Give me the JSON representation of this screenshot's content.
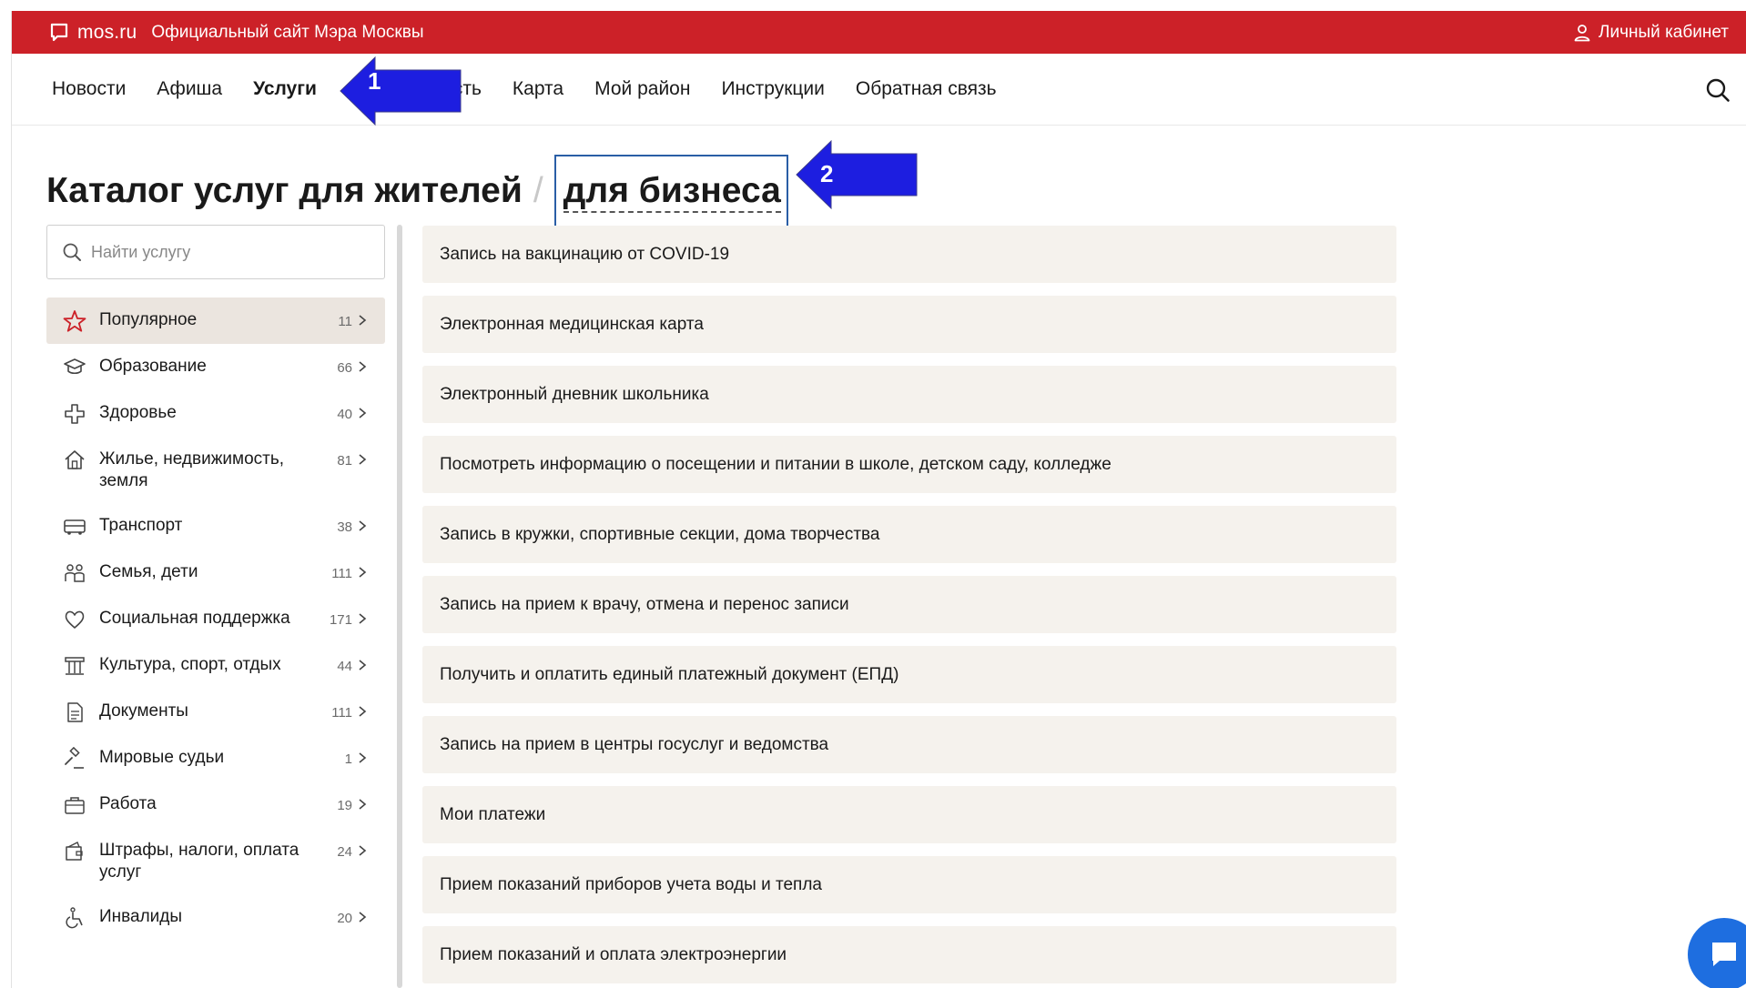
{
  "topbar": {
    "brand_name": "mos.ru",
    "brand_subtitle": "Официальный сайт Мэра Москвы",
    "cabinet_label": "Личный кабинет",
    "color": "#cc2128"
  },
  "nav": {
    "items": [
      "Новости",
      "Афиша",
      "Услуги",
      "Область",
      "Карта",
      "Мой район",
      "Инструкции",
      "Обратная связь"
    ],
    "visible_items": [
      "Новости",
      "Афиша",
      "Услуги",
      "ласть",
      "Карта",
      "Мой район",
      "Инструкции",
      "Обратная связь"
    ],
    "active": "Услуги"
  },
  "heading": {
    "title": "Каталог услуг для жителей",
    "separator": "/",
    "business_link": "для бизнеса"
  },
  "annotations": [
    {
      "number": "1",
      "color": "#1d1ee0"
    },
    {
      "number": "2",
      "color": "#1d1ee0"
    }
  ],
  "search": {
    "placeholder": "Найти услугу"
  },
  "categories": [
    {
      "label": "Популярное",
      "count": "11",
      "icon": "star-icon",
      "active": true
    },
    {
      "label": "Образование",
      "count": "66",
      "icon": "graduation-cap-icon"
    },
    {
      "label": "Здоровье",
      "count": "40",
      "icon": "medical-cross-icon"
    },
    {
      "label": "Жилье, недвижимость, земля",
      "count": "81",
      "icon": "house-icon"
    },
    {
      "label": "Транспорт",
      "count": "38",
      "icon": "bus-icon"
    },
    {
      "label": "Семья, дети",
      "count": "111",
      "icon": "family-icon"
    },
    {
      "label": "Социальная поддержка",
      "count": "171",
      "icon": "heart-hand-icon"
    },
    {
      "label": "Культура, спорт, отдых",
      "count": "44",
      "icon": "theatre-column-icon"
    },
    {
      "label": "Документы",
      "count": "111",
      "icon": "document-icon"
    },
    {
      "label": "Мировые судьи",
      "count": "1",
      "icon": "gavel-icon"
    },
    {
      "label": "Работа",
      "count": "19",
      "icon": "briefcase-icon"
    },
    {
      "label": "Штрафы, налоги, оплата услуг",
      "count": "24",
      "icon": "wallet-icon"
    },
    {
      "label": "Инвалиды",
      "count": "20",
      "icon": "wheelchair-icon"
    }
  ],
  "services": [
    "Запись на вакцинацию от COVID-19",
    "Электронная медицинская карта",
    "Электронный дневник школьника",
    "Посмотреть информацию о посещении и питании в школе, детском саду, колледже",
    "Запись в кружки, спортивные секции, дома творчества",
    "Запись на прием к врачу, отмена и перенос записи",
    "Получить и оплатить единый платежный документ (ЕПД)",
    "Запись на прием в центры госуслуг и ведомства",
    "Мои платежи",
    "Прием показаний приборов учета воды и тепла",
    "Прием показаний и оплата электроэнергии"
  ]
}
